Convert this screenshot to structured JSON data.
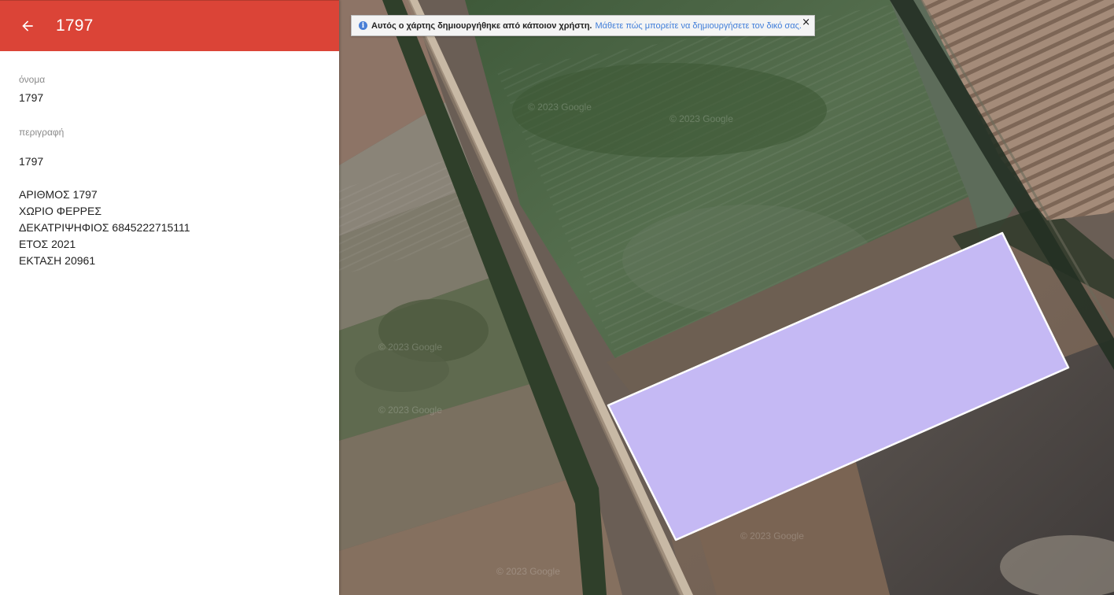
{
  "header": {
    "title": "1797",
    "back_icon": "arrow-back-icon",
    "color": "#db4437"
  },
  "details": {
    "name_label": "όνομα",
    "name_value": "1797",
    "description_label": "περιγραφή",
    "description_lines": [
      "1797",
      "",
      "ΑΡΙΘΜΟΣ 1797",
      "ΧΩΡΙΟ ΦΕΡΡΕΣ",
      "ΔΕΚΑΤΡΙΨΗΦΙΟΣ 6845222715111",
      "ΕΤΟΣ 2021",
      "ΕΚΤΑΣΗ 20961"
    ]
  },
  "map": {
    "notice_icon": "info-icon",
    "notice_text": "Αυτός ο χάρτης δημιουργήθηκε από κάποιον χρήστη.",
    "notice_link": "Μάθετε πώς μπορείτε να δημιουργήσετε τον δικό σας.",
    "notice_close": "×",
    "watermark": "© 2023 Google",
    "polygon_fill": "#c5b9f4",
    "polygon_stroke": "#ffffff"
  }
}
